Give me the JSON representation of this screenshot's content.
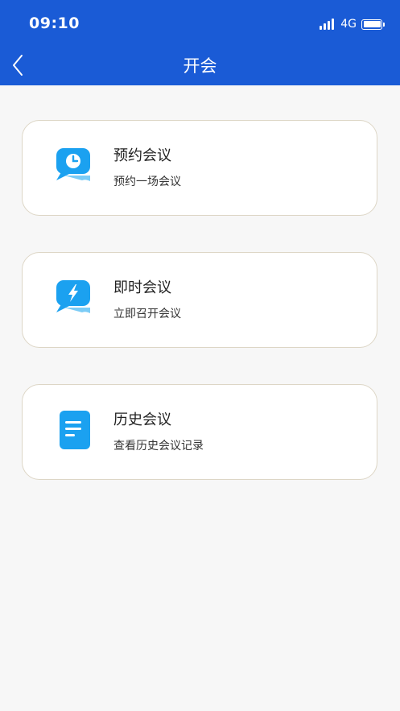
{
  "status_bar": {
    "time": "09:10",
    "network": "4G"
  },
  "nav": {
    "title": "开会",
    "back_icon": "chevron-left-icon"
  },
  "colors": {
    "header_bg": "#1a5bd6",
    "icon_blue": "#1ba1f0",
    "icon_light": "#7cccf6",
    "card_border": "#ddd6c6"
  },
  "cards": [
    {
      "title": "预约会议",
      "subtitle": "预约一场会议",
      "icon": "clock-chat-icon"
    },
    {
      "title": "即时会议",
      "subtitle": "立即召开会议",
      "icon": "lightning-chat-icon"
    },
    {
      "title": "历史会议",
      "subtitle": "查看历史会议记录",
      "icon": "document-icon"
    }
  ]
}
